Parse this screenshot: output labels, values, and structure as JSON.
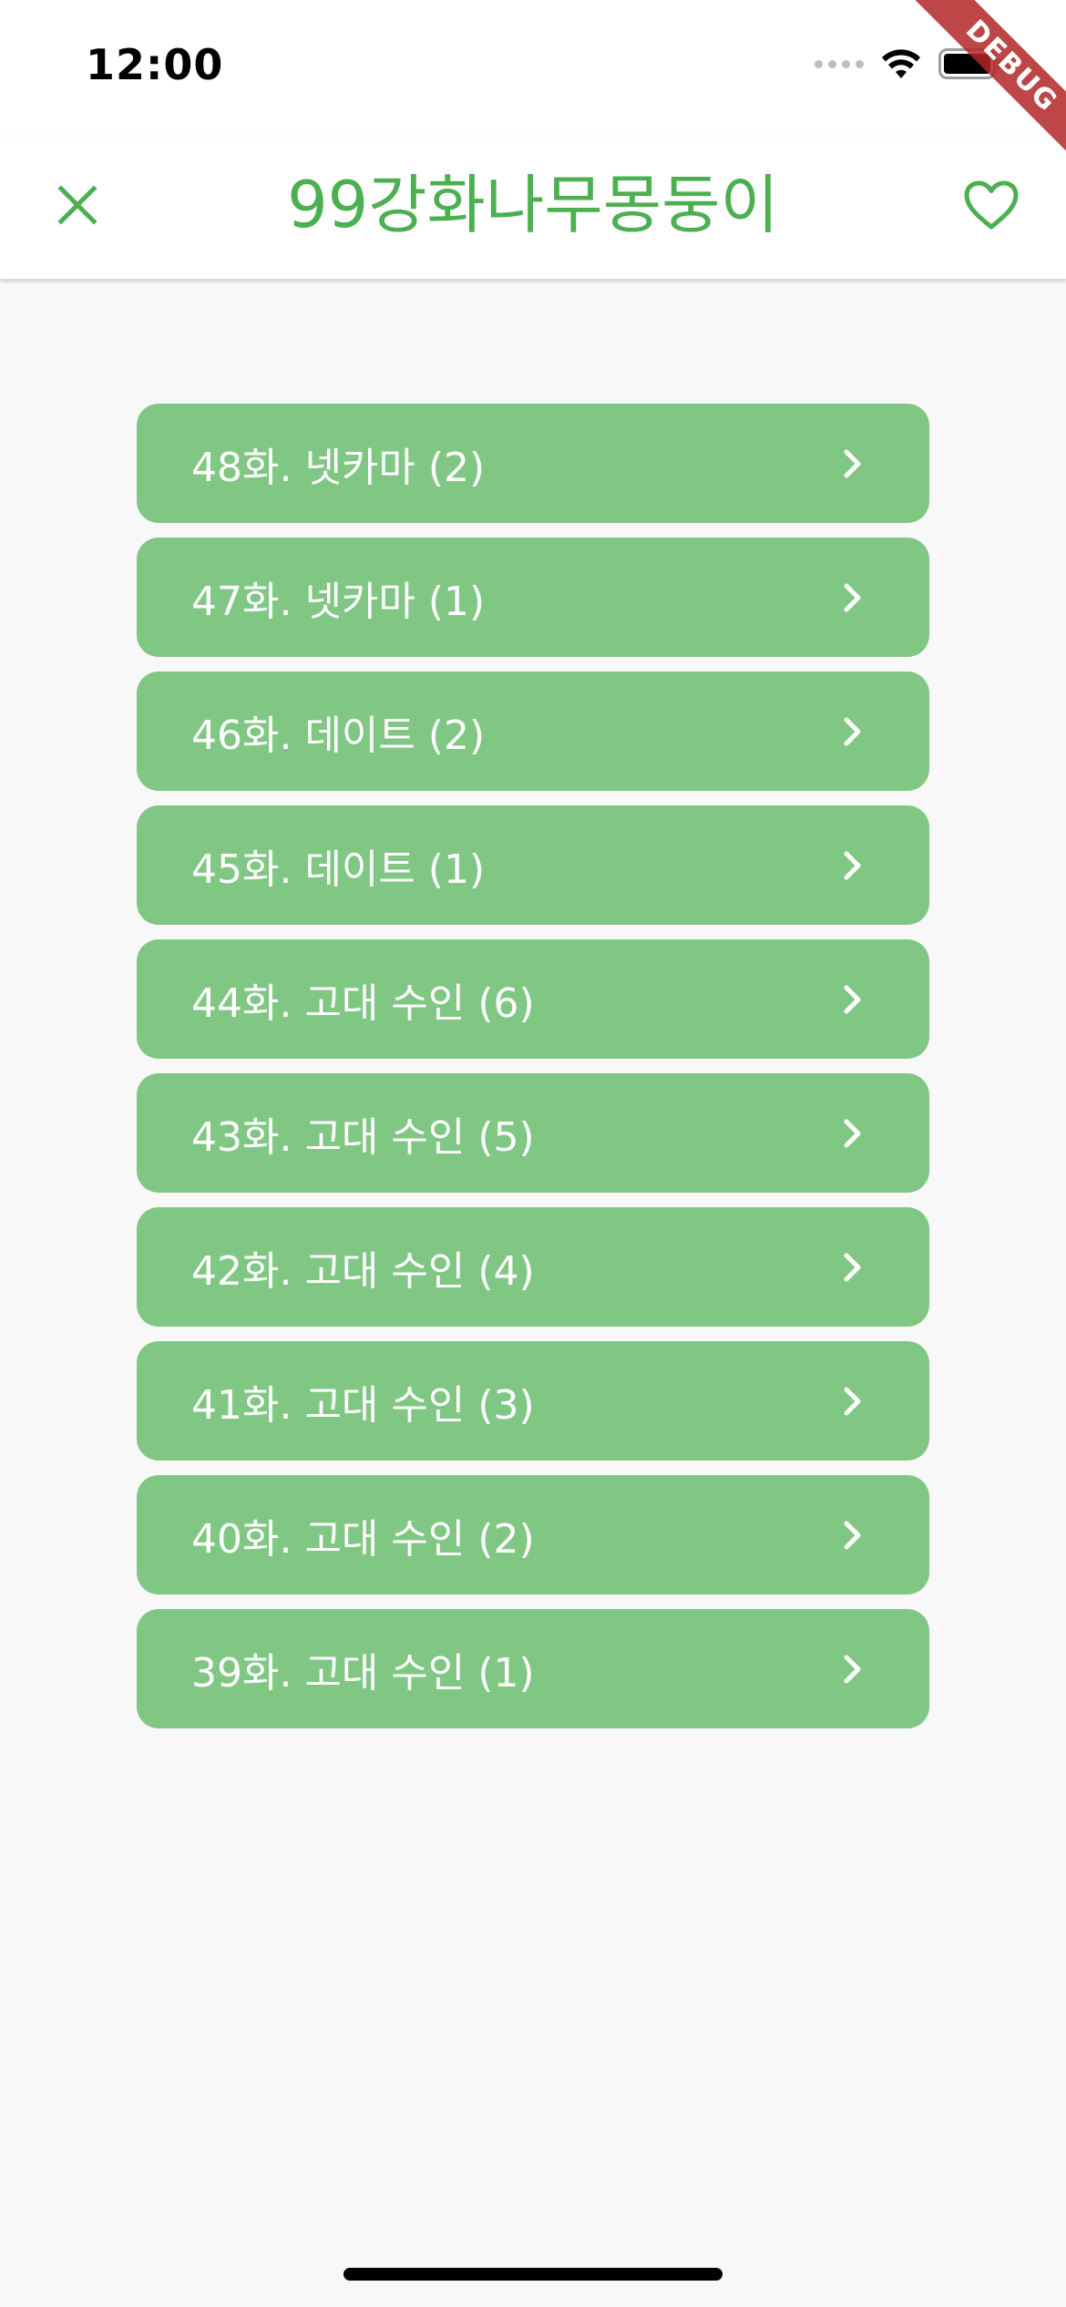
{
  "status_bar": {
    "time": "12:00",
    "signal_icon": "cellular-signal-dots-icon",
    "wifi_icon": "wifi-icon",
    "battery_icon": "battery-icon"
  },
  "app_bar": {
    "title": "99강화나무몽둥이",
    "close_icon": "close-icon",
    "favorite_icon": "heart-outline-icon",
    "accent_color": "#4caf50"
  },
  "episodes": [
    {
      "label": "48화. 넷카마 (2)"
    },
    {
      "label": "47화. 넷카마 (1)"
    },
    {
      "label": "46화. 데이트 (2)"
    },
    {
      "label": "45화. 데이트 (1)"
    },
    {
      "label": "44화. 고대 수인 (6)"
    },
    {
      "label": "43화. 고대 수인 (5)"
    },
    {
      "label": "42화. 고대 수인 (4)"
    },
    {
      "label": "41화. 고대 수인 (3)"
    },
    {
      "label": "40화. 고대 수인 (2)"
    },
    {
      "label": "39화. 고대 수인 (1)"
    }
  ],
  "list_item_color": "#81c784",
  "list_item_icon": "chevron-right-icon",
  "debug_banner": "DEBUG"
}
